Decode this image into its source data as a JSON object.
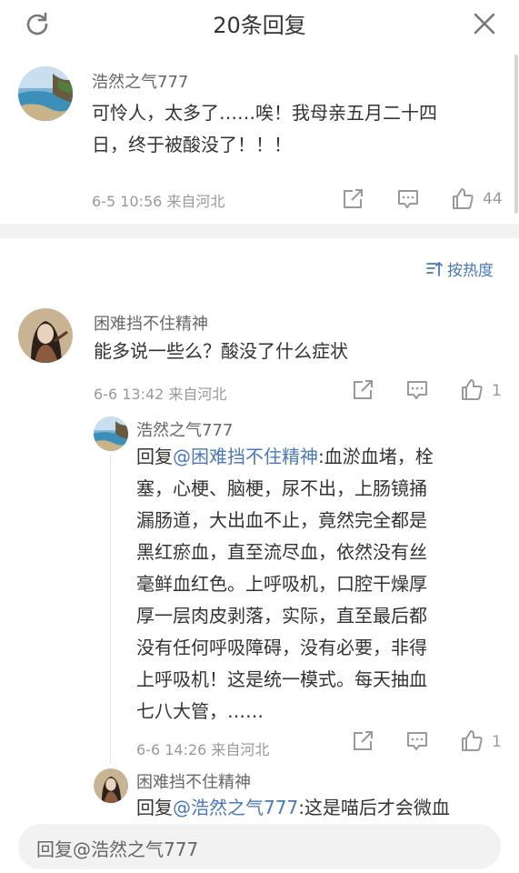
{
  "header": {
    "title": "20条回复"
  },
  "main_comment": {
    "user": "浩然之气777",
    "text_lines": [
      "可怜人，太多了……唉！我母亲五月二十四",
      "日，终于被酸没了！！！"
    ],
    "time": "6-5 10:56",
    "source": "来自河北",
    "likes": "44"
  },
  "sort": {
    "label": "按热度"
  },
  "comment1": {
    "user": "困难挡不住精神",
    "text": "能多说一些么？酸没了什么症状",
    "time": "6-6 13:42",
    "source": "来自河北",
    "likes": "1"
  },
  "reply1": {
    "user": "浩然之气777",
    "prefix": "回复",
    "mention": "@困难挡不住精神",
    "lines": [
      ":血淤血堵，栓",
      "塞，心梗、脑梗，尿不出，上肠镜捅",
      "漏肠道，大出血不止，竟然完全都是",
      "黑红瘀血，直至流尽血，依然没有丝",
      "毫鲜血红色。上呼吸机，口腔干燥厚",
      "厚一层肉皮剥落，实际，直至最后都",
      "没有任何呼吸障碍，没有必要，非得",
      "上呼吸机！这是统一模式。每天抽血",
      "七八大管，……"
    ],
    "time": "6-6 14:26",
    "source": "来自河北",
    "likes": "1"
  },
  "reply2": {
    "user": "困难挡不住精神",
    "prefix": "回复",
    "mention": "@浩然之气777",
    "line": ":这是喵后才会微血"
  },
  "reply_input": {
    "placeholder": "回复@浩然之气777"
  },
  "icons": {
    "refresh": "refresh-icon",
    "close": "close-icon",
    "share": "share-icon",
    "comment": "comment-icon",
    "like": "thumbs-up-icon",
    "sort": "sort-icon"
  },
  "colors": {
    "link": "#4a79b7",
    "muted": "#999999",
    "text": "#333333",
    "divider": "#f2f2f2"
  }
}
